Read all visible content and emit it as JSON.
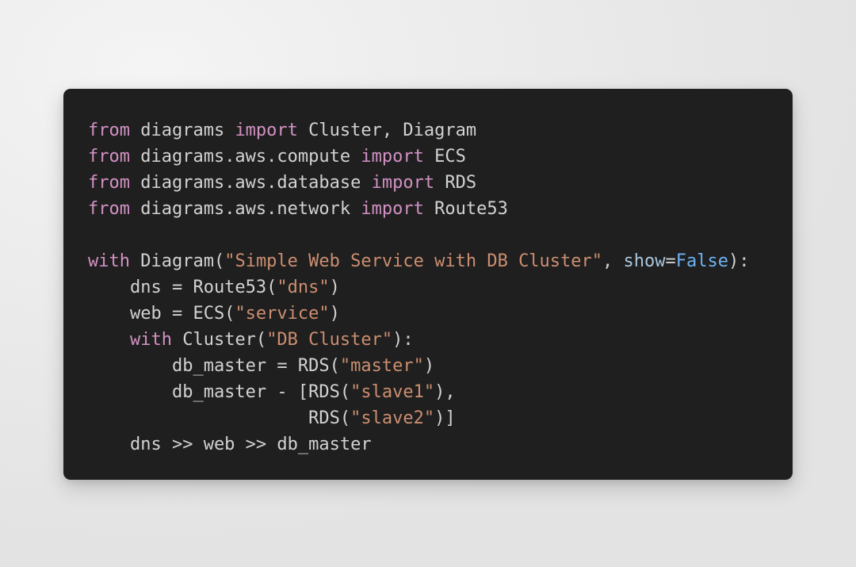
{
  "page": {
    "background_color": "#ececec",
    "card_background_color": "#1f1f1f"
  },
  "code": {
    "language": "python",
    "theme_colors": {
      "default_text": "#d2d2d2",
      "keyword": "#d291c4",
      "string": "#cc8e70",
      "builtin_constant": "#6db3f2",
      "parameter": "#a9c7dd",
      "background": "#1f1f1f"
    },
    "lines": [
      {
        "n": 1,
        "text": "from diagrams import Cluster, Diagram",
        "tokens": [
          {
            "t": "from",
            "c": "kw"
          },
          {
            "t": " diagrams ",
            "c": "txt"
          },
          {
            "t": "import",
            "c": "kw"
          },
          {
            "t": " Cluster, Diagram",
            "c": "txt"
          }
        ]
      },
      {
        "n": 2,
        "text": "from diagrams.aws.compute import ECS",
        "tokens": [
          {
            "t": "from",
            "c": "kw"
          },
          {
            "t": " diagrams.aws.compute ",
            "c": "txt"
          },
          {
            "t": "import",
            "c": "kw"
          },
          {
            "t": " ECS",
            "c": "txt"
          }
        ]
      },
      {
        "n": 3,
        "text": "from diagrams.aws.database import RDS",
        "tokens": [
          {
            "t": "from",
            "c": "kw"
          },
          {
            "t": " diagrams.aws.database ",
            "c": "txt"
          },
          {
            "t": "import",
            "c": "kw"
          },
          {
            "t": " RDS",
            "c": "txt"
          }
        ]
      },
      {
        "n": 4,
        "text": "from diagrams.aws.network import Route53",
        "tokens": [
          {
            "t": "from",
            "c": "kw"
          },
          {
            "t": " diagrams.aws.network ",
            "c": "txt"
          },
          {
            "t": "import",
            "c": "kw"
          },
          {
            "t": " Route53",
            "c": "txt"
          }
        ]
      },
      {
        "n": 5,
        "text": "",
        "tokens": []
      },
      {
        "n": 6,
        "text": "with Diagram(\"Simple Web Service with DB Cluster\", show=False):",
        "tokens": [
          {
            "t": "with",
            "c": "kw"
          },
          {
            "t": " Diagram(",
            "c": "txt"
          },
          {
            "t": "\"Simple Web Service with DB Cluster\"",
            "c": "str"
          },
          {
            "t": ", ",
            "c": "txt"
          },
          {
            "t": "show",
            "c": "param"
          },
          {
            "t": "=",
            "c": "txt"
          },
          {
            "t": "False",
            "c": "bi"
          },
          {
            "t": "):",
            "c": "txt"
          }
        ]
      },
      {
        "n": 7,
        "text": "    dns = Route53(\"dns\")",
        "tokens": [
          {
            "t": "    dns = Route53(",
            "c": "txt"
          },
          {
            "t": "\"dns\"",
            "c": "str"
          },
          {
            "t": ")",
            "c": "txt"
          }
        ]
      },
      {
        "n": 8,
        "text": "    web = ECS(\"service\")",
        "tokens": [
          {
            "t": "    web = ECS(",
            "c": "txt"
          },
          {
            "t": "\"service\"",
            "c": "str"
          },
          {
            "t": ")",
            "c": "txt"
          }
        ]
      },
      {
        "n": 9,
        "text": "    with Cluster(\"DB Cluster\"):",
        "tokens": [
          {
            "t": "    ",
            "c": "txt"
          },
          {
            "t": "with",
            "c": "kw"
          },
          {
            "t": " Cluster(",
            "c": "txt"
          },
          {
            "t": "\"DB Cluster\"",
            "c": "str"
          },
          {
            "t": "):",
            "c": "txt"
          }
        ]
      },
      {
        "n": 10,
        "text": "        db_master = RDS(\"master\")",
        "tokens": [
          {
            "t": "        db_master = RDS(",
            "c": "txt"
          },
          {
            "t": "\"master\"",
            "c": "str"
          },
          {
            "t": ")",
            "c": "txt"
          }
        ]
      },
      {
        "n": 11,
        "text": "        db_master - [RDS(\"slave1\"),",
        "tokens": [
          {
            "t": "        db_master - [RDS(",
            "c": "txt"
          },
          {
            "t": "\"slave1\"",
            "c": "str"
          },
          {
            "t": "),",
            "c": "txt"
          }
        ]
      },
      {
        "n": 12,
        "text": "                     RDS(\"slave2\")]",
        "tokens": [
          {
            "t": "                     RDS(",
            "c": "txt"
          },
          {
            "t": "\"slave2\"",
            "c": "str"
          },
          {
            "t": ")]",
            "c": "txt"
          }
        ]
      },
      {
        "n": 13,
        "text": "    dns >> web >> db_master",
        "tokens": [
          {
            "t": "    dns >> web >> db_master",
            "c": "txt"
          }
        ]
      }
    ]
  }
}
